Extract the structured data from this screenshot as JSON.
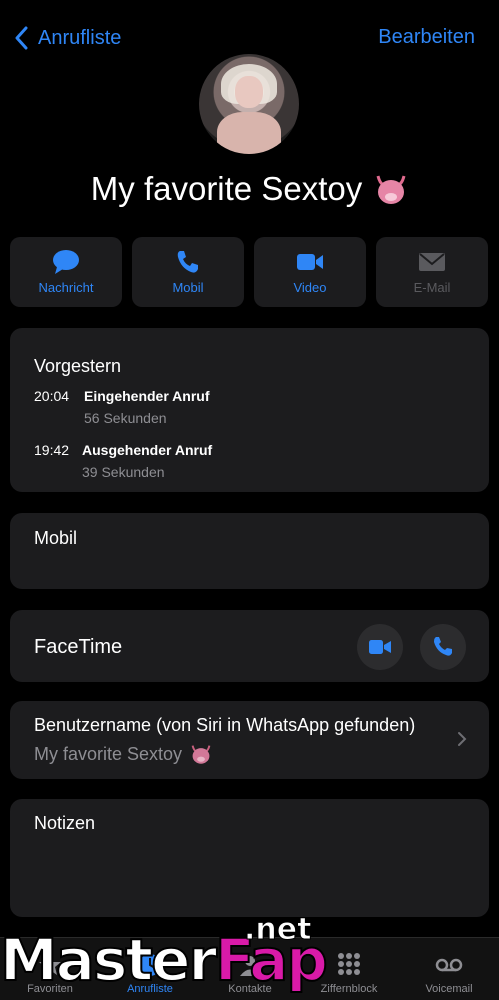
{
  "nav": {
    "back_label": "Anrufliste",
    "edit_label": "Bearbeiten"
  },
  "contact": {
    "name": "My favorite Sextoy"
  },
  "actions": [
    {
      "label": "Nachricht",
      "icon": "message-icon",
      "enabled": true
    },
    {
      "label": "Mobil",
      "icon": "phone-icon",
      "enabled": true
    },
    {
      "label": "Video",
      "icon": "video-icon",
      "enabled": true
    },
    {
      "label": "E-Mail",
      "icon": "mail-icon",
      "enabled": false
    }
  ],
  "recent": {
    "title": "Vorgestern",
    "calls": [
      {
        "time": "20:04",
        "type": "Eingehender Anruf",
        "duration": "56 Sekunden"
      },
      {
        "time": "19:42",
        "type": "Ausgehender Anruf",
        "duration": "39 Sekunden"
      }
    ]
  },
  "mobil": {
    "label": "Mobil"
  },
  "facetime": {
    "label": "FaceTime"
  },
  "username": {
    "label": "Benutzername (von Siri in WhatsApp gefunden)",
    "value": "My favorite Sextoy"
  },
  "notes": {
    "label": "Notizen"
  },
  "tabs": [
    {
      "label": "Favoriten",
      "icon": "star-icon"
    },
    {
      "label": "Anrufliste",
      "icon": "clock-icon",
      "active": true
    },
    {
      "label": "Kontakte",
      "icon": "person-icon"
    },
    {
      "label": "Ziffernblock",
      "icon": "keypad-icon"
    },
    {
      "label": "Voicemail",
      "icon": "voicemail-icon"
    }
  ],
  "watermark": {
    "brand1": "Master",
    "brand2": "Fap",
    "suffix": ".net"
  },
  "colors": {
    "accent": "#2f86f6",
    "card": "#1c1c1e",
    "watermark_pink": "#d91aa8"
  }
}
